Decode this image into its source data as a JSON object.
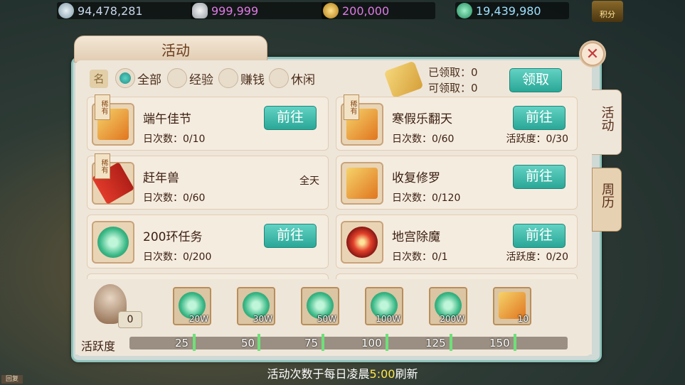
{
  "currencies": [
    {
      "icon": "silver-cloud-icon",
      "value": "94,478,281"
    },
    {
      "icon": "silver-ingot-icon",
      "value": "999,999"
    },
    {
      "icon": "copper-coin-icon",
      "value": "200,000"
    },
    {
      "icon": "jade-coin-icon",
      "value": "19,439,980"
    }
  ],
  "jifen_label": "积分",
  "window": {
    "title": "活动",
    "close_symbol": "✕"
  },
  "filters": [
    {
      "label": "全部",
      "selected": true
    },
    {
      "label": "经验",
      "selected": false
    },
    {
      "label": "赚钱",
      "selected": false
    },
    {
      "label": "休闲",
      "selected": false
    }
  ],
  "category_glyph": "名",
  "claim": {
    "received_label": "已领取：0",
    "available_label": "可领取：0",
    "button": "领取"
  },
  "rare_tag": "稀有",
  "activities": [
    {
      "name": "端午佳节",
      "count": "日次数：0/10",
      "vitality": "",
      "time": "",
      "button": "前往",
      "rare": true,
      "art": "chest"
    },
    {
      "name": "寒假乐翻天",
      "count": "日次数：0/60",
      "vitality": "活跃度：0/30",
      "time": "",
      "button": "前往",
      "rare": true,
      "art": "chest"
    },
    {
      "name": "赶年兽",
      "count": "日次数：0/60",
      "vitality": "",
      "time": "全天",
      "button": "",
      "rare": true,
      "art": "firecracker"
    },
    {
      "name": "收复修罗",
      "count": "日次数：0/120",
      "vitality": "",
      "time": "",
      "button": "前往",
      "rare": false,
      "art": "chest"
    },
    {
      "name": "200环任务",
      "count": "日次数：0/200",
      "vitality": "",
      "time": "",
      "button": "前往",
      "rare": false,
      "art": "jade"
    },
    {
      "name": "地宫除魔",
      "count": "日次数：0/1",
      "vitality": "活跃度：0/20",
      "time": "",
      "button": "前往",
      "rare": false,
      "art": "eye"
    }
  ],
  "side_tabs": [
    "活动",
    "周历"
  ],
  "vitality_counter": "0",
  "rewards": [
    {
      "label": "20W",
      "art": "jade"
    },
    {
      "label": "30W",
      "art": "jade"
    },
    {
      "label": "50W",
      "art": "jade"
    },
    {
      "label": "100W",
      "art": "jade"
    },
    {
      "label": "200W",
      "art": "jade"
    },
    {
      "label": "10",
      "art": "chest"
    }
  ],
  "vitality_label": "活跃度",
  "milestones": [
    "25",
    "50",
    "75",
    "100",
    "125",
    "150"
  ],
  "vitality_progress": 0,
  "footer": {
    "before": "活动次数于每日凌晨",
    "time": "5:00",
    "after": "刷新"
  },
  "mini_label": "回复"
}
